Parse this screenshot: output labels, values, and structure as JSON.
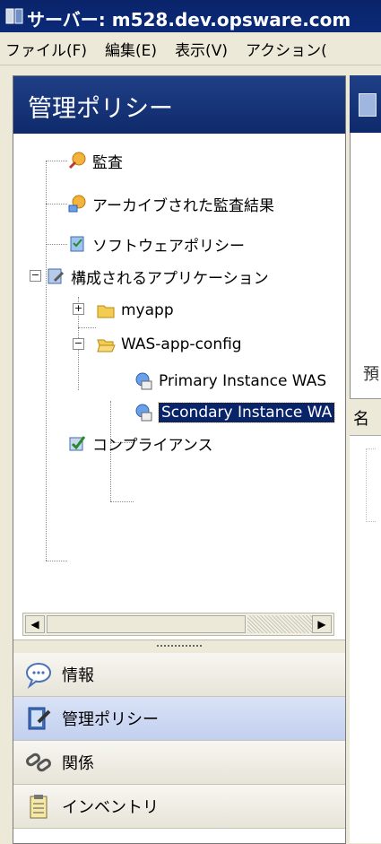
{
  "window": {
    "title": "サーバー: m528.dev.opsware.com"
  },
  "menu": [
    "ファイル(F)",
    "編集(E)",
    "表示(V)",
    "アクション("
  ],
  "panel": {
    "header": "管理ポリシー"
  },
  "tree": {
    "audit": "監査",
    "archived_audit": "アーカイブされた監査結果",
    "software_policy": "ソフトウェアポリシー",
    "configured_apps": "構成されるアプリケーション",
    "myapp": "myapp",
    "was_app_config": "WAS-app-config",
    "primary_instance": "Primary Instance WAS",
    "secondary_instance": "Scondary Instance WA",
    "compliance": "コンプライアンス"
  },
  "nav": {
    "info": "情報",
    "management_policy": "管理ポリシー",
    "relationships": "関係",
    "inventory": "インベントリ"
  },
  "right": {
    "char1": "預",
    "col_header": "名"
  },
  "colors": {
    "title_bar": "#0a246a",
    "selection": "#0a246a",
    "active_nav": "#c2d0ef"
  }
}
